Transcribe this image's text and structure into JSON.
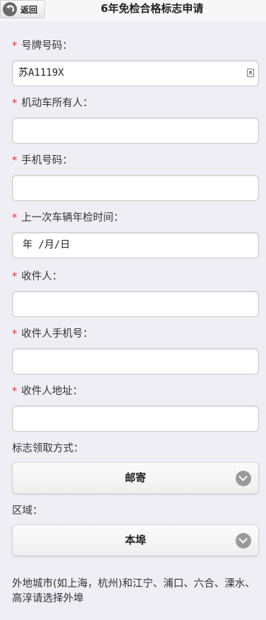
{
  "header": {
    "back_label": "返回",
    "title": "6年免检合格标志申请"
  },
  "fields": {
    "plate": {
      "required_mark": "*",
      "label": "号牌号码：",
      "value": "苏A1119X"
    },
    "owner": {
      "required_mark": "*",
      "label": "机动车所有人：",
      "value": ""
    },
    "phone": {
      "required_mark": "*",
      "label": "手机号码：",
      "value": ""
    },
    "last_inspection": {
      "required_mark": "*",
      "label": "上一次车辆年检时间：",
      "value": "年 /月/日"
    },
    "recipient": {
      "required_mark": "*",
      "label": "收件人：",
      "value": ""
    },
    "recipient_phone": {
      "required_mark": "*",
      "label": "收件人手机号：",
      "value": ""
    },
    "recipient_address": {
      "required_mark": "*",
      "label": "收件人地址：",
      "value": ""
    }
  },
  "pickup": {
    "label": "标志领取方式：",
    "selected": "邮寄"
  },
  "region": {
    "label": "区域：",
    "selected": "本埠"
  },
  "note": "外地城市(如上海，杭州)和江宁、浦口、六合、溧水、高淳请选择外埠",
  "colors": {
    "required": "#d0302a",
    "background": "#efeef5"
  }
}
